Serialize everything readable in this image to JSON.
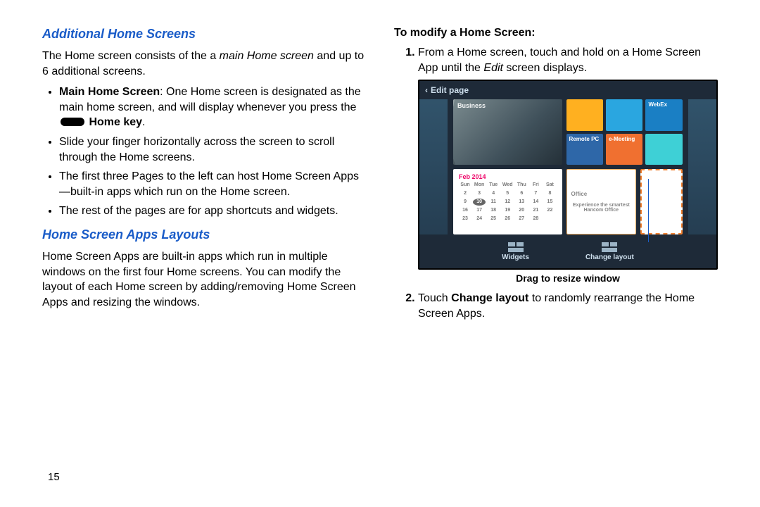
{
  "page_number": "15",
  "left": {
    "section1_title": "Additional Home Screens",
    "intro_a": "The Home screen consists of the a ",
    "intro_em": "main Home screen",
    "intro_b": " and up to 6 additional screens.",
    "bullet1_lead": "Main Home Screen",
    "bullet1_a": ": One Home screen is designated as the main home screen, and will display whenever you press the ",
    "bullet1_key": "Home key",
    "bullet1_b": ".",
    "bullet2": "Slide your finger horizontally across the screen to scroll through the Home screens.",
    "bullet3": "The first three Pages to the left can host Home Screen Apps—built-in apps which run on the Home screen.",
    "bullet4": "The rest of the pages are for app shortcuts and widgets.",
    "section2_title": "Home Screen Apps Layouts",
    "section2_body": "Home Screen Apps are built-in apps which run in multiple windows on the first four Home screens. You can modify the layout of each Home screen by adding/removing Home Screen Apps and resizing the windows."
  },
  "right": {
    "sub_title": "To modify a Home Screen:",
    "step1_a": "From a Home screen, touch and hold on a Home Screen App until the ",
    "step1_em": "Edit",
    "step1_b": " screen displays.",
    "step2_a": "Touch ",
    "step2_strong": "Change layout",
    "step2_b": " to randomly rearrange the Home Screen Apps.",
    "caption": "Drag to resize window"
  },
  "shot": {
    "editbar": "Edit page",
    "tile_business": "Business",
    "tile_remotepc": "Remote PC",
    "tile_webex": "WebEx",
    "tile_evernote": "e-Meeting",
    "office_label": "Office",
    "office_body": "Experience the smartest Hancom Office",
    "cal_label": "Feb 2014",
    "cal_days": [
      "Sun",
      "Mon",
      "Tue",
      "Wed",
      "Thu",
      "Fri",
      "Sat"
    ],
    "widgets": "Widgets",
    "change_layout": "Change layout"
  }
}
